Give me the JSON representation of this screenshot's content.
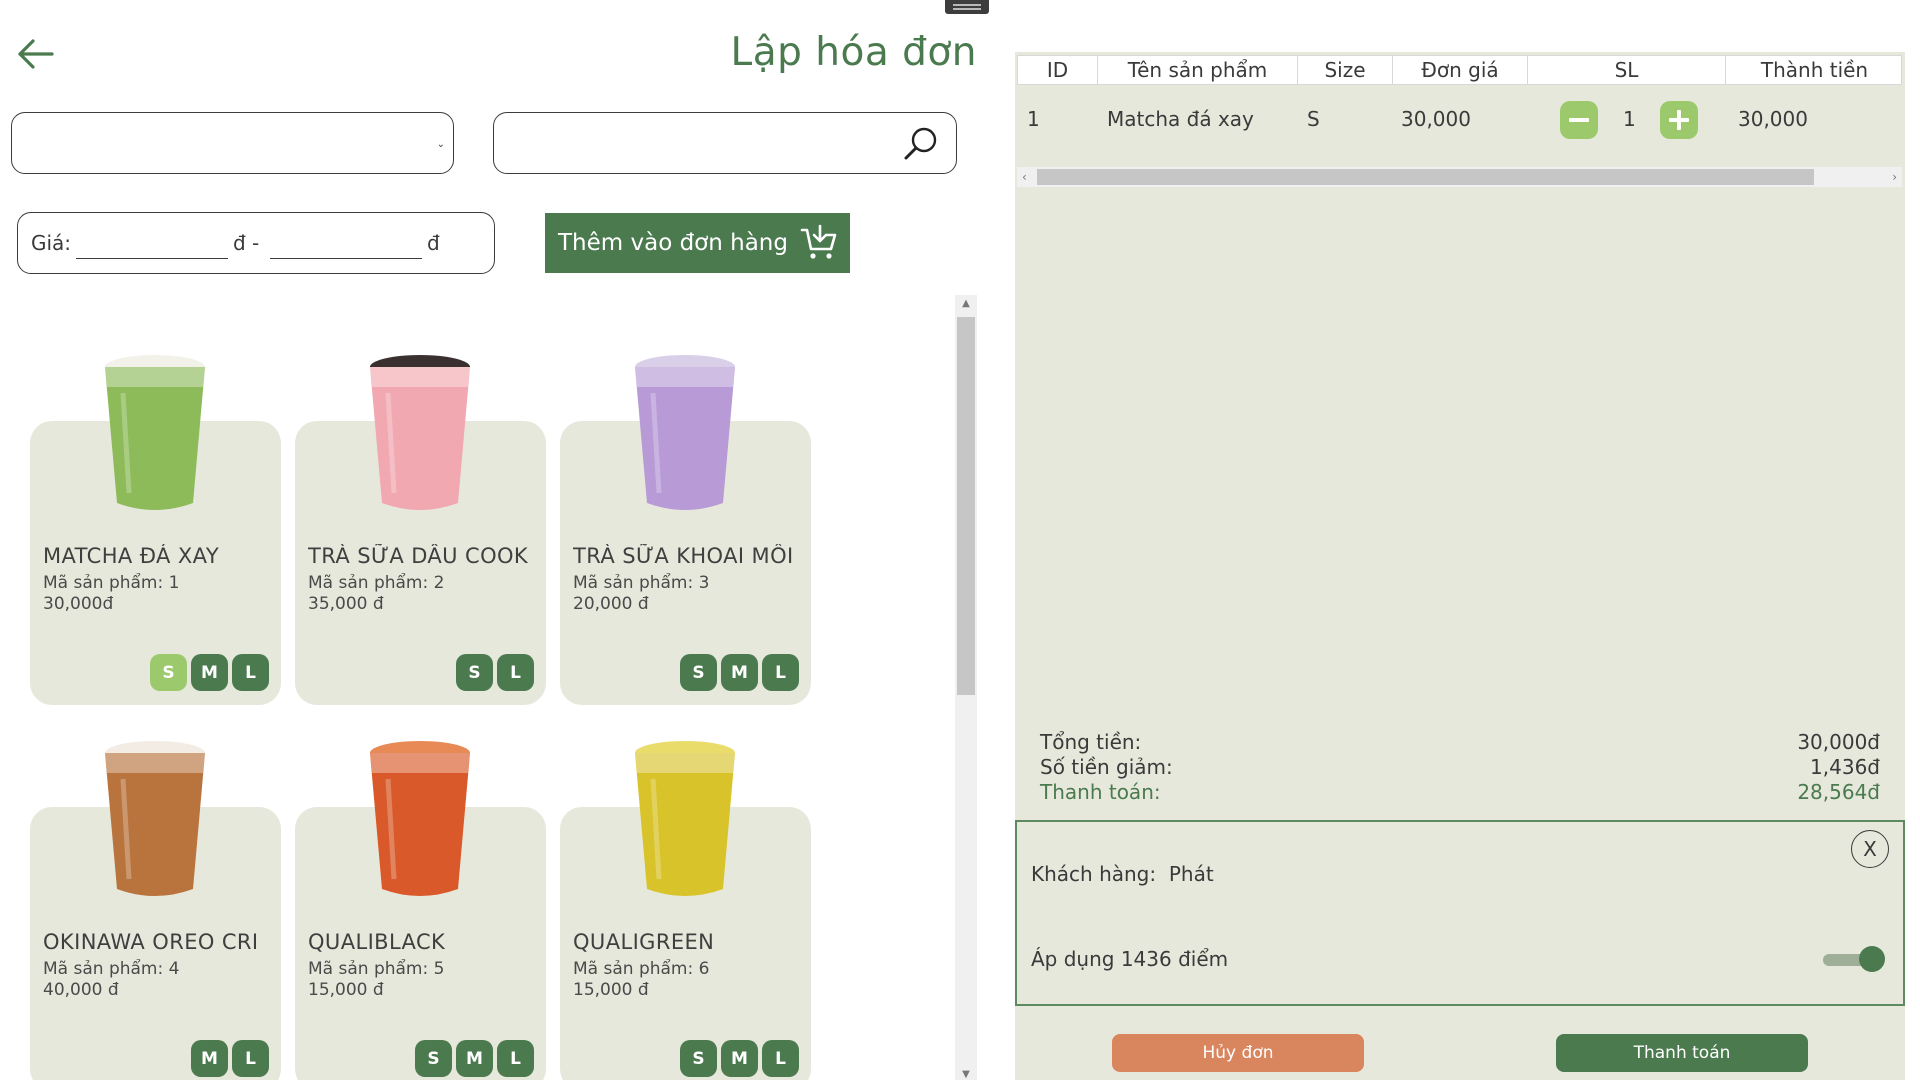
{
  "header": {
    "title": "Lập hóa đơn"
  },
  "filters": {
    "category_value": "",
    "search_value": "",
    "price_label": "Giá:",
    "currency": "đ -",
    "currency_end": "đ",
    "price_from": "",
    "price_to": ""
  },
  "toolbar": {
    "add_to_order_label": "Thêm vào đơn hàng"
  },
  "products": [
    {
      "name": "MATCHA ĐÁ XAY",
      "code": "Mã sản phẩm: 1",
      "price": "30,000đ",
      "sizes": [
        "S",
        "M",
        "L"
      ],
      "selected": "S",
      "cup_color": "#8dbb5a",
      "lid_color": "#f2f2ea"
    },
    {
      "name": "TRÀ SỮA DÂU COOK",
      "code": "Mã sản phẩm: 2",
      "price": "35,000 đ",
      "sizes": [
        "S",
        "L"
      ],
      "selected": "",
      "cup_color": "#f1a8b0",
      "lid_color": "#3a3030"
    },
    {
      "name": "TRÀ SỮA KHOAI MÔI",
      "code": "Mã sản phẩm: 3",
      "price": "20,000 đ",
      "sizes": [
        "S",
        "M",
        "L"
      ],
      "selected": "",
      "cup_color": "#b79ad6",
      "lid_color": "#d9cfe8"
    },
    {
      "name": "OKINAWA OREO CRI",
      "code": "Mã sản phẩm: 4",
      "price": "40,000 đ",
      "sizes": [
        "M",
        "L"
      ],
      "selected": "",
      "cup_color": "#b9743e",
      "lid_color": "#f3ece4"
    },
    {
      "name": "QUALIBLACK",
      "code": "Mã sản phẩm: 5",
      "price": "15,000 đ",
      "sizes": [
        "S",
        "M",
        "L"
      ],
      "selected": "",
      "cup_color": "#d9592a",
      "lid_color": "#e88a56"
    },
    {
      "name": "QUALIGREEN",
      "code": "Mã sản phẩm: 6",
      "price": "15,000 đ",
      "sizes": [
        "S",
        "M",
        "L"
      ],
      "selected": "",
      "cup_color": "#d8c42a",
      "lid_color": "#e9dc6a"
    }
  ],
  "order": {
    "columns": [
      "ID",
      "Tên sản phẩm",
      "Size",
      "Đơn giá",
      "SL",
      "Thành tiền"
    ],
    "rows": [
      {
        "id": "1",
        "name": "Matcha đá xay",
        "size": "S",
        "unit_price": "30,000",
        "qty": "1",
        "total": "30,000"
      }
    ]
  },
  "totals": {
    "total_label": "Tổng tiền:",
    "total_value": "30,000đ",
    "discount_label": "Số tiền giảm:",
    "discount_value": "1,436đ",
    "pay_label": "Thanh toán:",
    "pay_value": "28,564đ"
  },
  "customer": {
    "label": "Khách hàng:",
    "name": "Phát",
    "apply_points_label": "Áp dụng 1436 điểm",
    "apply_points_on": true,
    "close_label": "X"
  },
  "actions": {
    "cancel_label": "Hủy đơn",
    "pay_label": "Thanh toán"
  },
  "colors": {
    "primary": "#4b7a4f",
    "accent_light": "#9cc96b",
    "panel": "#e7e8dc",
    "cancel": "#d9855e"
  }
}
